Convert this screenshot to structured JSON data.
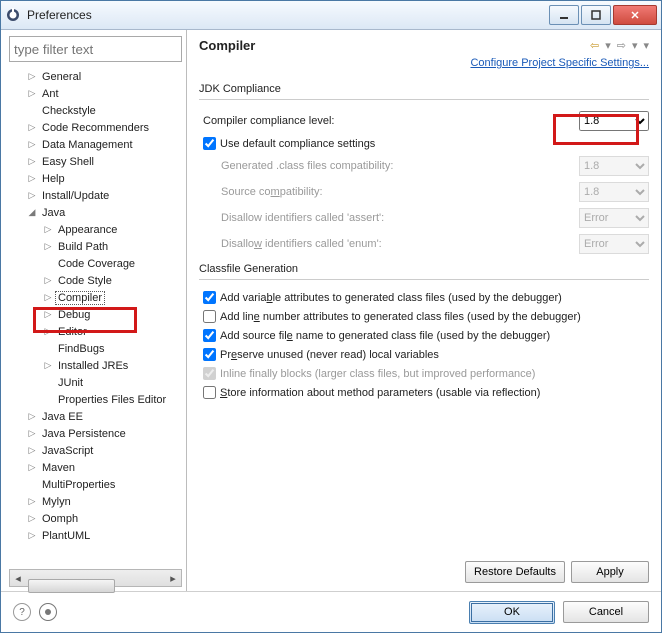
{
  "window": {
    "title": "Preferences"
  },
  "sidebar": {
    "filter_placeholder": "type filter text",
    "items": [
      {
        "label": "General",
        "tw": "▷"
      },
      {
        "label": "Ant",
        "tw": "▷"
      },
      {
        "label": "Checkstyle",
        "tw": ""
      },
      {
        "label": "Code Recommenders",
        "tw": "▷"
      },
      {
        "label": "Data Management",
        "tw": "▷"
      },
      {
        "label": "Easy Shell",
        "tw": "▷"
      },
      {
        "label": "Help",
        "tw": "▷"
      },
      {
        "label": "Install/Update",
        "tw": "▷"
      },
      {
        "label": "Java",
        "tw": "▲",
        "children": [
          {
            "label": "Appearance",
            "tw": "▷"
          },
          {
            "label": "Build Path",
            "tw": "▷"
          },
          {
            "label": "Code Coverage",
            "tw": ""
          },
          {
            "label": "Code Style",
            "tw": "▷"
          },
          {
            "label": "Compiler",
            "tw": "▷",
            "sel": true
          },
          {
            "label": "Debug",
            "tw": "▷"
          },
          {
            "label": "Editor",
            "tw": "▷"
          },
          {
            "label": "FindBugs",
            "tw": ""
          },
          {
            "label": "Installed JREs",
            "tw": "▷"
          },
          {
            "label": "JUnit",
            "tw": ""
          },
          {
            "label": "Properties Files Editor",
            "tw": ""
          }
        ]
      },
      {
        "label": "Java EE",
        "tw": "▷"
      },
      {
        "label": "Java Persistence",
        "tw": "▷"
      },
      {
        "label": "JavaScript",
        "tw": "▷"
      },
      {
        "label": "Maven",
        "tw": "▷"
      },
      {
        "label": "MultiProperties",
        "tw": ""
      },
      {
        "label": "Mylyn",
        "tw": "▷"
      },
      {
        "label": "Oomph",
        "tw": "▷"
      },
      {
        "label": "PlantUML",
        "tw": "▷"
      }
    ]
  },
  "main": {
    "title": "Compiler",
    "config_link": "Configure Project Specific Settings...",
    "jdk": {
      "group": "JDK Compliance",
      "compliance_label": "Compiler compliance level:",
      "compliance_value": "1.8",
      "use_default": "Use default compliance settings",
      "gen_class": "Generated .class files compatibility:",
      "gen_class_value": "1.8",
      "src_compat": "Source compatibility:",
      "src_compat_value": "1.8",
      "assert_label": "Disallow identifiers called 'assert':",
      "assert_value": "Error",
      "enum_label": "Disallow identifiers called 'enum':",
      "enum_value": "Error"
    },
    "cf": {
      "group": "Classfile Generation",
      "var_attr": "Add variable attributes to generated class files (used by the debugger)",
      "line_num": "Add line number attributes to generated class files (used by the debugger)",
      "src_file": "Add source file name to generated class file (used by the debugger)",
      "preserve": "Preserve unused (never read) local variables",
      "inline": "Inline finally blocks (larger class files, but improved performance)",
      "store": "Store information about method parameters (usable via reflection)"
    },
    "buttons": {
      "restore": "Restore Defaults",
      "apply": "Apply"
    }
  },
  "footer": {
    "ok": "OK",
    "cancel": "Cancel"
  }
}
